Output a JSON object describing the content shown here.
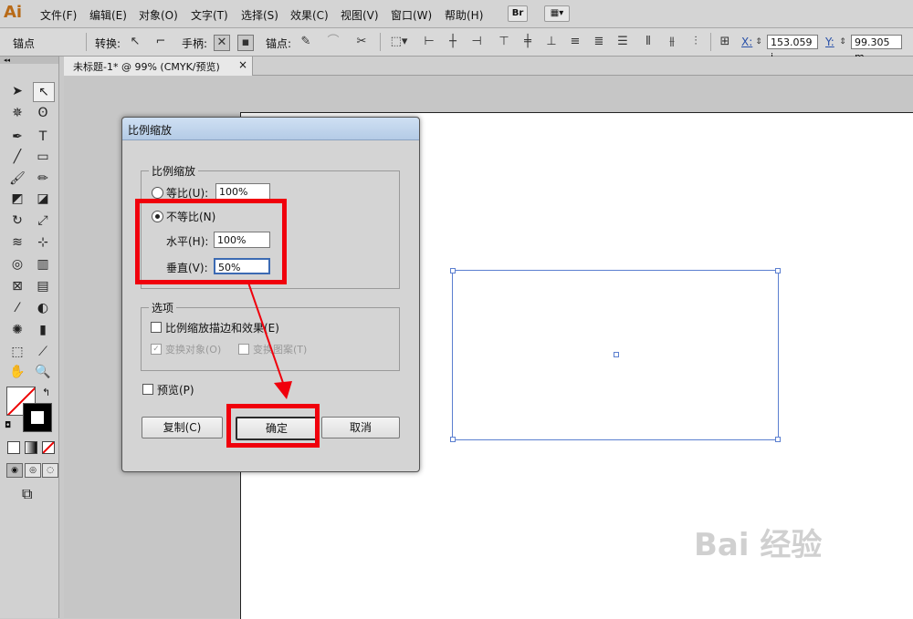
{
  "app": {
    "logo": "Ai"
  },
  "menu": [
    "文件(F)",
    "编辑(E)",
    "对象(O)",
    "文字(T)",
    "选择(S)",
    "效果(C)",
    "视图(V)",
    "窗口(W)",
    "帮助(H)"
  ],
  "menu_extra": {
    "bridge": "Br"
  },
  "control": {
    "mode": "锚点",
    "convert": "转换:",
    "handles": "手柄:",
    "anchors": "锚点:",
    "x_label": "X:",
    "x_value": "153.059 i",
    "y_label": "Y:",
    "y_value": "99.305 m"
  },
  "doc_tab": {
    "title": "未标题-1* @ 99% (CMYK/预览)",
    "close": "×"
  },
  "dialog": {
    "title": "比例缩放",
    "scale_group": "比例缩放",
    "uniform_label": "等比(U):",
    "uniform_value": "100%",
    "nonuniform_label": "不等比(N)",
    "horizontal_label": "水平(H):",
    "horizontal_value": "100%",
    "vertical_label": "垂直(V):",
    "vertical_value": "50%",
    "options_group": "选项",
    "scale_strokes": "比例缩放描边和效果(E)",
    "transform_objects": "变换对象(O)",
    "transform_patterns": "变换图案(T)",
    "preview": "预览(P)",
    "copy_button": "复制(C)",
    "ok_button": "确定",
    "cancel_button": "取消"
  },
  "watermark": "Bai 经验",
  "colors": {
    "highlight": "#f0000c",
    "selection": "#5b7fd0"
  }
}
